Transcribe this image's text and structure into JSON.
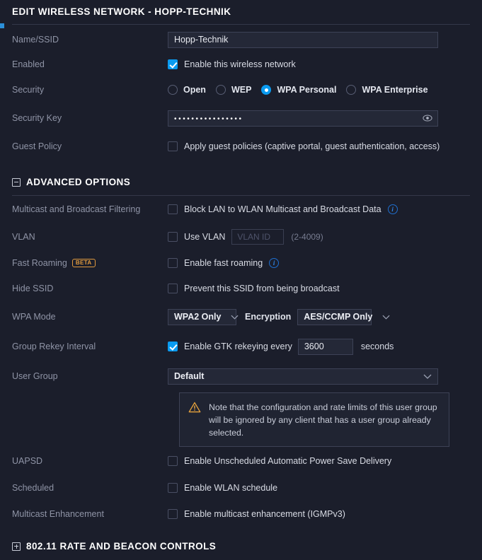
{
  "header": {
    "title": "EDIT WIRELESS NETWORK - HOPP-TECHNIK"
  },
  "sections": {
    "advanced": {
      "title": "ADVANCED OPTIONS",
      "icon": "minus-box-icon",
      "expanded": true
    },
    "rate_beacon": {
      "title": "802.11 RATE AND BEACON CONTROLS",
      "icon": "plus-box-icon",
      "expanded": false
    }
  },
  "fields": {
    "name_ssid": {
      "label": "Name/SSID",
      "value": "Hopp-Technik",
      "placeholder": ""
    },
    "enabled": {
      "label": "Enabled",
      "checkbox_label": "Enable this wireless network",
      "checked": true
    },
    "security": {
      "label": "Security",
      "options": [
        "Open",
        "WEP",
        "WPA Personal",
        "WPA Enterprise"
      ],
      "selected": "WPA Personal"
    },
    "security_key": {
      "label": "Security Key",
      "value": "••••••••••••••••",
      "reveal_icon": "eye-icon"
    },
    "guest_policy": {
      "label": "Guest Policy",
      "checkbox_label": "Apply guest policies (captive portal, guest authentication, access)",
      "checked": false
    },
    "multicast_broadcast_filtering": {
      "label": "Multicast and Broadcast Filtering",
      "checkbox_label": "Block LAN to WLAN Multicast and Broadcast Data",
      "checked": false,
      "info": "i"
    },
    "vlan": {
      "label": "VLAN",
      "checkbox_label": "Use VLAN",
      "checked": false,
      "input_value": "",
      "input_placeholder": "VLAN ID",
      "range_hint": "(2-4009)"
    },
    "fast_roaming": {
      "label": "Fast Roaming",
      "badge": "BETA",
      "checkbox_label": "Enable fast roaming",
      "checked": false,
      "info": "i"
    },
    "hide_ssid": {
      "label": "Hide SSID",
      "checkbox_label": "Prevent this SSID from being broadcast",
      "checked": false
    },
    "wpa_mode": {
      "label": "WPA Mode",
      "value": "WPA2 Only",
      "encryption_label": "Encryption",
      "encryption_value": "AES/CCMP Only"
    },
    "group_rekey": {
      "label": "Group Rekey Interval",
      "checkbox_label": "Enable GTK rekeying every",
      "checked": true,
      "value": "3600",
      "unit": "seconds"
    },
    "user_group": {
      "label": "User Group",
      "value": "Default",
      "note_icon": "warning-triangle-icon",
      "note": "Note that the configuration and rate limits of this user group will be ignored by any client that has a user group already selected."
    },
    "uapsd": {
      "label": "UAPSD",
      "checkbox_label": "Enable Unscheduled Automatic Power Save Delivery",
      "checked": false
    },
    "scheduled": {
      "label": "Scheduled",
      "checkbox_label": "Enable WLAN schedule",
      "checked": false
    },
    "multicast_enhancement": {
      "label": "Multicast Enhancement",
      "checkbox_label": "Enable multicast enhancement (IGMPv3)",
      "checked": false
    }
  },
  "colors": {
    "background": "#1b1e2b",
    "accent_blue": "#0a9bf0",
    "badge_orange": "#e09a3e",
    "info_blue": "#2f86e8",
    "warning_orange": "#e8a33d"
  }
}
